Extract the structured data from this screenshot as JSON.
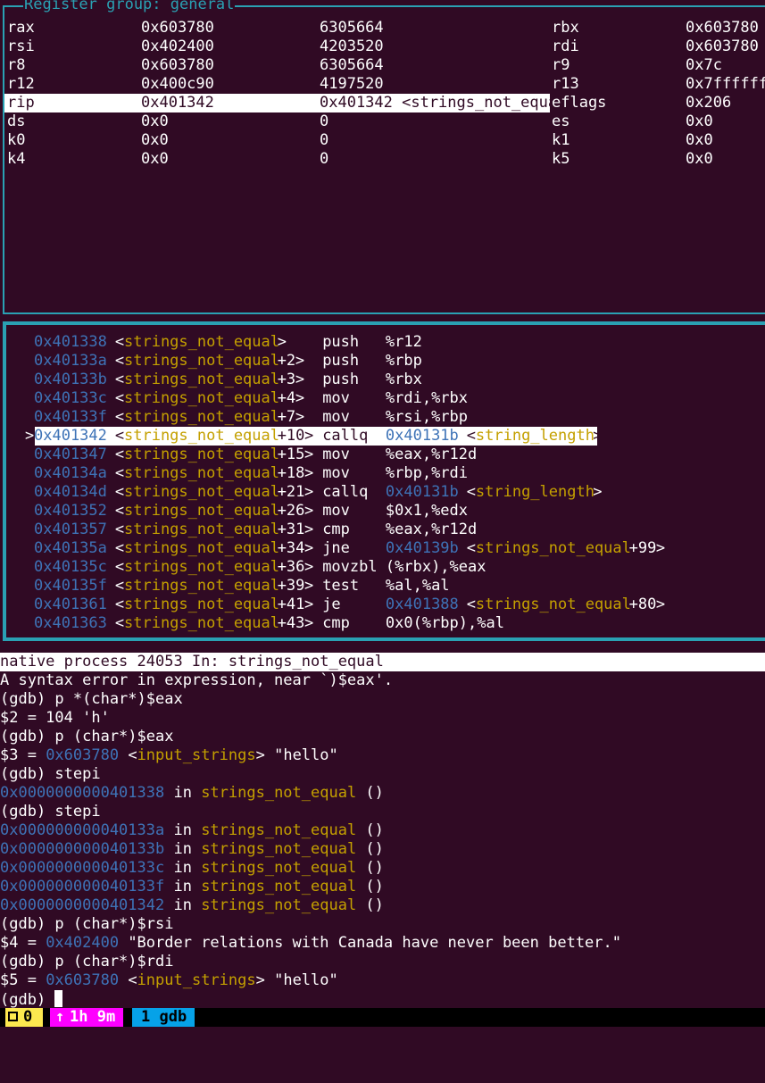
{
  "regs": {
    "title": "Register group: general",
    "rows": [
      {
        "n1": "rax",
        "h1": "0x603780",
        "d1": "6305664",
        "n2": "rbx",
        "h2": "0x603780"
      },
      {
        "n1": "rsi",
        "h1": "0x402400",
        "d1": "4203520",
        "n2": "rdi",
        "h2": "0x603780"
      },
      {
        "n1": "r8",
        "h1": "0x603780",
        "d1": "6305664",
        "n2": "r9",
        "h2": "0x7c"
      },
      {
        "n1": "r12",
        "h1": "0x400c90",
        "d1": "4197520",
        "n2": "r13",
        "h2": "0x7ffffff"
      },
      {
        "n1": "rip",
        "h1": "0x401342",
        "d1": "0x401342 <strings_not_equa",
        "n2": "eflags",
        "h2": "0x206"
      },
      {
        "n1": "ds",
        "h1": "0x0",
        "d1": "0",
        "n2": "es",
        "h2": "0x0"
      },
      {
        "n1": "k0",
        "h1": "0x0",
        "d1": "0",
        "n2": "k1",
        "h2": "0x0"
      },
      {
        "n1": "k4",
        "h1": "0x0",
        "d1": "0",
        "n2": "k5",
        "h2": "0x0"
      }
    ]
  },
  "asm": {
    "marker": ">",
    "rows": [
      {
        "addr": "0x401338",
        "fn": "strings_not_equal",
        "off": "",
        "mn": "push",
        "ops": "%r12",
        "tgt": "",
        "tsym": "",
        "toff": ""
      },
      {
        "addr": "0x40133a",
        "fn": "strings_not_equal",
        "off": "+2",
        "mn": "push",
        "ops": "%rbp",
        "tgt": "",
        "tsym": "",
        "toff": ""
      },
      {
        "addr": "0x40133b",
        "fn": "strings_not_equal",
        "off": "+3",
        "mn": "push",
        "ops": "%rbx",
        "tgt": "",
        "tsym": "",
        "toff": ""
      },
      {
        "addr": "0x40133c",
        "fn": "strings_not_equal",
        "off": "+4",
        "mn": "mov",
        "ops": "%rdi,%rbx",
        "tgt": "",
        "tsym": "",
        "toff": ""
      },
      {
        "addr": "0x40133f",
        "fn": "strings_not_equal",
        "off": "+7",
        "mn": "mov",
        "ops": "%rsi,%rbp",
        "tgt": "",
        "tsym": "",
        "toff": ""
      },
      {
        "addr": "0x401342",
        "fn": "strings_not_equal",
        "off": "+10",
        "mn": "callq",
        "ops": "",
        "tgt": "0x40131b",
        "tsym": "string_length",
        "toff": ""
      },
      {
        "addr": "0x401347",
        "fn": "strings_not_equal",
        "off": "+15",
        "mn": "mov",
        "ops": "%eax,%r12d",
        "tgt": "",
        "tsym": "",
        "toff": ""
      },
      {
        "addr": "0x40134a",
        "fn": "strings_not_equal",
        "off": "+18",
        "mn": "mov",
        "ops": "%rbp,%rdi",
        "tgt": "",
        "tsym": "",
        "toff": ""
      },
      {
        "addr": "0x40134d",
        "fn": "strings_not_equal",
        "off": "+21",
        "mn": "callq",
        "ops": "",
        "tgt": "0x40131b",
        "tsym": "string_length",
        "toff": ""
      },
      {
        "addr": "0x401352",
        "fn": "strings_not_equal",
        "off": "+26",
        "mn": "mov",
        "ops": "$0x1,%edx",
        "tgt": "",
        "tsym": "",
        "toff": ""
      },
      {
        "addr": "0x401357",
        "fn": "strings_not_equal",
        "off": "+31",
        "mn": "cmp",
        "ops": "%eax,%r12d",
        "tgt": "",
        "tsym": "",
        "toff": ""
      },
      {
        "addr": "0x40135a",
        "fn": "strings_not_equal",
        "off": "+34",
        "mn": "jne",
        "ops": "",
        "tgt": "0x40139b",
        "tsym": "strings_not_equal",
        "toff": "+99"
      },
      {
        "addr": "0x40135c",
        "fn": "strings_not_equal",
        "off": "+36",
        "mn": "movzbl",
        "ops": "(%rbx),%eax",
        "tgt": "",
        "tsym": "",
        "toff": ""
      },
      {
        "addr": "0x40135f",
        "fn": "strings_not_equal",
        "off": "+39",
        "mn": "test",
        "ops": "%al,%al",
        "tgt": "",
        "tsym": "",
        "toff": ""
      },
      {
        "addr": "0x401361",
        "fn": "strings_not_equal",
        "off": "+41",
        "mn": "je",
        "ops": "",
        "tgt": "0x401388",
        "tsym": "strings_not_equal",
        "toff": "+80"
      },
      {
        "addr": "0x401363",
        "fn": "strings_not_equal",
        "off": "+43",
        "mn": "cmp",
        "ops": "0x0(%rbp),%al",
        "tgt": "",
        "tsym": "",
        "toff": ""
      }
    ]
  },
  "status": {
    "text": "native process 24053 In: strings_not_equal"
  },
  "console": {
    "lines": [
      [
        {
          "t": "A syntax error in expression, near `)$eax'."
        }
      ],
      [
        {
          "t": "(gdb) p *(char*)$eax"
        }
      ],
      [
        {
          "t": "$2 = 104 'h'"
        }
      ],
      [
        {
          "t": "(gdb) p (char*)$eax"
        }
      ],
      [
        {
          "t": "$3 = "
        },
        {
          "t": "0x603780",
          "c": "addr"
        },
        {
          "t": " <"
        },
        {
          "t": "input_strings",
          "c": "sym"
        },
        {
          "t": "> \"hello\""
        }
      ],
      [
        {
          "t": "(gdb) stepi"
        }
      ],
      [
        {
          "t": "0x0000000000401338",
          "c": "addr"
        },
        {
          "t": " in "
        },
        {
          "t": "strings_not_equal",
          "c": "sym"
        },
        {
          "t": " ()"
        }
      ],
      [
        {
          "t": "(gdb) stepi"
        }
      ],
      [
        {
          "t": "0x000000000040133a",
          "c": "addr"
        },
        {
          "t": " in "
        },
        {
          "t": "strings_not_equal",
          "c": "sym"
        },
        {
          "t": " ()"
        }
      ],
      [
        {
          "t": "0x000000000040133b",
          "c": "addr"
        },
        {
          "t": " in "
        },
        {
          "t": "strings_not_equal",
          "c": "sym"
        },
        {
          "t": " ()"
        }
      ],
      [
        {
          "t": "0x000000000040133c",
          "c": "addr"
        },
        {
          "t": " in "
        },
        {
          "t": "strings_not_equal",
          "c": "sym"
        },
        {
          "t": " ()"
        }
      ],
      [
        {
          "t": "0x000000000040133f",
          "c": "addr"
        },
        {
          "t": " in "
        },
        {
          "t": "strings_not_equal",
          "c": "sym"
        },
        {
          "t": " ()"
        }
      ],
      [
        {
          "t": "0x0000000000401342",
          "c": "addr"
        },
        {
          "t": " in "
        },
        {
          "t": "strings_not_equal",
          "c": "sym"
        },
        {
          "t": " ()"
        }
      ],
      [
        {
          "t": "(gdb) p (char*)$rsi"
        }
      ],
      [
        {
          "t": "$4 = "
        },
        {
          "t": "0x402400",
          "c": "addr"
        },
        {
          "t": " \"Border relations with Canada have never been better.\""
        }
      ],
      [
        {
          "t": "(gdb) p (char*)$rdi"
        }
      ],
      [
        {
          "t": "$5 = "
        },
        {
          "t": "0x603780",
          "c": "addr"
        },
        {
          "t": " <"
        },
        {
          "t": "input_strings",
          "c": "sym"
        },
        {
          "t": "> \"hello\""
        }
      ]
    ],
    "prompt": "(gdb) "
  },
  "tmux": {
    "session": "0",
    "uptime": "1h 9m",
    "uptime_arrow": "↑",
    "window": "1 gdb",
    "colors": {
      "session_bg": "#fce94f",
      "uptime_bg": "#ff00ff",
      "window_bg": "#06a2e8"
    }
  },
  "theme": {
    "bg": "#300a24",
    "border": "#2aa1b3",
    "addr": "#3e73b7",
    "sym": "#c4a000"
  }
}
